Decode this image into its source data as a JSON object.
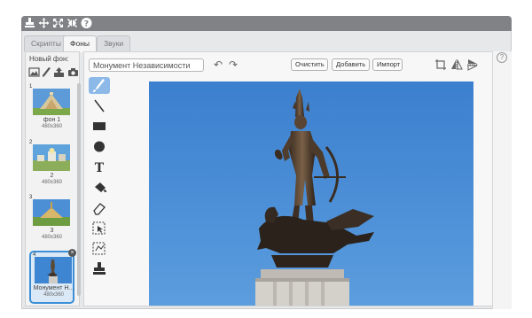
{
  "topbar": {
    "icons": [
      "stamp-icon",
      "move-icon",
      "grow-icon",
      "shrink-icon",
      "help-icon"
    ]
  },
  "tabs": [
    {
      "label": "Скрипты"
    },
    {
      "label": "Фоны"
    },
    {
      "label": "Звуки"
    }
  ],
  "sidebar": {
    "new_backdrop_label": "Новый фон:",
    "new_icons": [
      "image-icon",
      "paint-brush-icon",
      "upload-icon",
      "camera-icon"
    ],
    "items": [
      {
        "num": "1",
        "name": "фон 1",
        "res": "480x360"
      },
      {
        "num": "2",
        "name": "2",
        "res": "480x360"
      },
      {
        "num": "3",
        "name": "3",
        "res": "480x360"
      },
      {
        "num": "4",
        "name": "Монумент Н...",
        "res": "480x360",
        "selected": true
      }
    ]
  },
  "editor": {
    "costume_name": "Монумент Независимости",
    "clear_label": "Очистить",
    "add_label": "Добавить",
    "import_label": "Импорт",
    "tools": [
      "brush-tool",
      "line-tool",
      "rectangle-tool",
      "ellipse-tool",
      "text-tool",
      "fill-tool",
      "eraser-tool",
      "select-tool",
      "reshape-tool",
      "stamp-tool"
    ],
    "text_tool_glyph": "T"
  },
  "help": {
    "glyph": "?"
  },
  "colors": {
    "accent": "#3c8fd6",
    "topbar": "#808285",
    "sky": "#3f86d2"
  }
}
